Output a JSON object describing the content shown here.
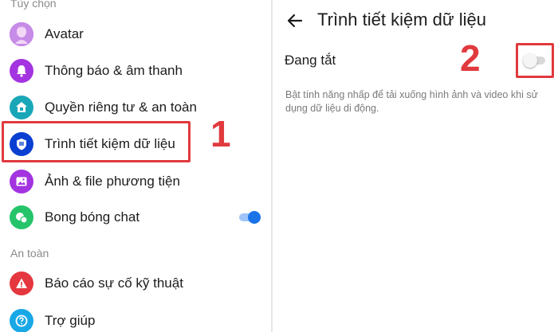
{
  "left_panel": {
    "section_options": "Tùy chọn",
    "section_safety": "An toàn",
    "items": [
      {
        "label": "Avatar",
        "icon": "avatar-icon"
      },
      {
        "label": "Thông báo & âm thanh",
        "icon": "bell-icon"
      },
      {
        "label": "Quyền riêng tư & an toàn",
        "icon": "home-lock-icon"
      },
      {
        "label": "Trình tiết kiệm dữ liệu",
        "icon": "shield-icon"
      },
      {
        "label": "Ảnh & file phương tiện",
        "icon": "image-icon"
      },
      {
        "label": "Bong bóng chat",
        "icon": "chat-bubble-icon"
      }
    ],
    "safety_items": [
      {
        "label": "Báo cáo sự cố kỹ thuật",
        "icon": "warning-icon"
      },
      {
        "label": "Trợ giúp",
        "icon": "help-icon"
      }
    ],
    "chat_bubble_toggle": true
  },
  "annotations": {
    "step1": "1",
    "step2": "2",
    "highlight_color": "#e03a3e"
  },
  "right_panel": {
    "title": "Trình tiết kiệm dữ liệu",
    "status_label": "Đang tắt",
    "data_saver_enabled": false,
    "description": "Bật tính năng nhấp để tải xuống hình ảnh và video khi sử dụng dữ liệu di động."
  },
  "colors": {
    "accent": "#1a73e8",
    "purple": "#a334e0",
    "teal": "#19a7b8",
    "blue": "#0a3fd1",
    "green": "#25c46a",
    "red": "#e5373f",
    "sky": "#18a8e6"
  }
}
